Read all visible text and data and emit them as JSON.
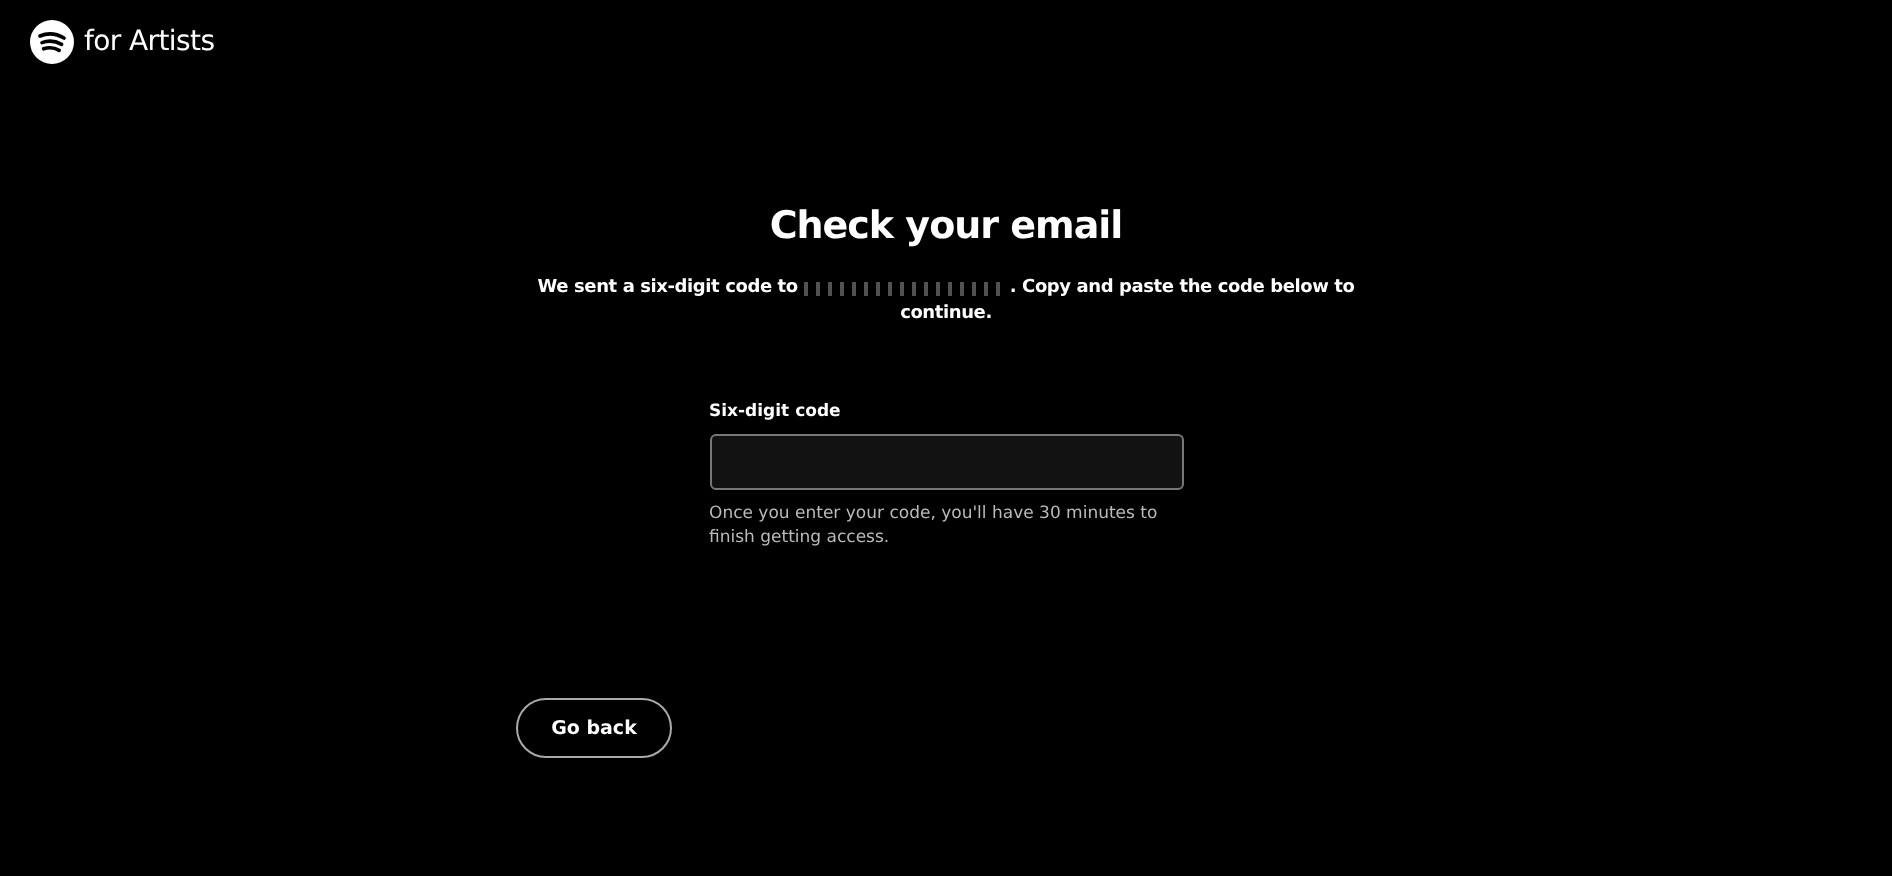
{
  "logo": {
    "text": "for Artists"
  },
  "heading": "Check your email",
  "message": {
    "before": "We sent a six-digit code to",
    "after": ". Copy and paste the code below to",
    "last_line": "continue."
  },
  "code_field": {
    "label": "Six-digit code",
    "hint": "Once you enter your code, you'll have 30 minutes to finish getting access."
  },
  "buttons": [
    {
      "label": "Go back"
    }
  ]
}
